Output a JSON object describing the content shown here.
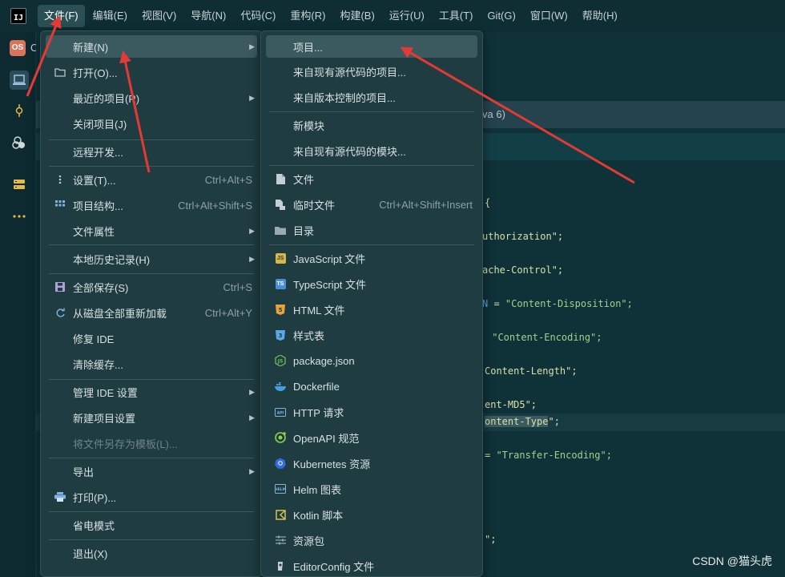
{
  "menubar": {
    "logo": "IJ",
    "items": [
      "文件(F)",
      "编辑(E)",
      "视图(V)",
      "导航(N)",
      "代码(C)",
      "重构(R)",
      "构建(B)",
      "运行(U)",
      "工具(T)",
      "Git(G)",
      "窗口(W)",
      "帮助(H)"
    ]
  },
  "sidebar": {
    "project_badge": "OS",
    "project_initial": "O"
  },
  "editor": {
    "java_hint": "va 6)",
    "lines": [
      {
        "t": "{"
      },
      {
        "t": "uthorization\";"
      },
      {
        "t": "ache-Control\";"
      },
      {
        "a": "N",
        "b": " = ",
        "c": "\"Content-Disposition\";"
      },
      {
        "b": " ",
        "c": "\"Content-Encoding\";"
      },
      {
        "t": "Content-Length\";"
      },
      {
        "t": "ent-MD5\";"
      },
      {
        "s": "ontent-Type",
        "t2": "\";"
      },
      {
        "b": "= ",
        "c": "\"Transfer-Encoding\";"
      },
      {
        "t": "\";"
      }
    ]
  },
  "file_menu": {
    "items": [
      {
        "icon": "",
        "label": "新建(N)",
        "shortcut": "",
        "arrow": true,
        "highlight": true
      },
      {
        "icon": "folder-icon",
        "label": "打开(O)...",
        "shortcut": "",
        "arrow": false
      },
      {
        "icon": "",
        "label": "最近的项目(R)",
        "shortcut": "",
        "arrow": true
      },
      {
        "icon": "",
        "label": "关闭项目(J)",
        "shortcut": "",
        "arrow": false
      },
      {
        "icon": "",
        "label": "远程开发...",
        "shortcut": "",
        "arrow": false
      },
      {
        "icon": "more-vert-icon",
        "label": "设置(T)...",
        "shortcut": "Ctrl+Alt+S",
        "arrow": false
      },
      {
        "icon": "grid-icon",
        "label": "项目结构...",
        "shortcut": "Ctrl+Alt+Shift+S",
        "arrow": false
      },
      {
        "icon": "",
        "label": "文件属性",
        "shortcut": "",
        "arrow": true
      },
      {
        "icon": "",
        "label": "本地历史记录(H)",
        "shortcut": "",
        "arrow": true
      },
      {
        "icon": "save-icon",
        "label": "全部保存(S)",
        "shortcut": "Ctrl+S",
        "arrow": false
      },
      {
        "icon": "reload-icon",
        "label": "从磁盘全部重新加载",
        "shortcut": "Ctrl+Alt+Y",
        "arrow": false
      },
      {
        "icon": "",
        "label": "修复 IDE",
        "shortcut": "",
        "arrow": false
      },
      {
        "icon": "",
        "label": "清除缓存...",
        "shortcut": "",
        "arrow": false
      },
      {
        "icon": "",
        "label": "管理 IDE 设置",
        "shortcut": "",
        "arrow": true
      },
      {
        "icon": "",
        "label": "新建项目设置",
        "shortcut": "",
        "arrow": true
      },
      {
        "icon": "",
        "label": "将文件另存为模板(L)...",
        "shortcut": "",
        "arrow": false,
        "disabled": true
      },
      {
        "icon": "",
        "label": "导出",
        "shortcut": "",
        "arrow": true
      },
      {
        "icon": "printer-icon",
        "label": "打印(P)...",
        "shortcut": "",
        "arrow": false
      },
      {
        "icon": "",
        "label": "省电模式",
        "shortcut": "",
        "arrow": false
      },
      {
        "icon": "",
        "label": "退出(X)",
        "shortcut": "",
        "arrow": false
      }
    ]
  },
  "new_menu": {
    "items": [
      {
        "icon": "",
        "label": "项目...",
        "shortcut": "",
        "highlight": true
      },
      {
        "icon": "",
        "label": "来自现有源代码的项目...",
        "shortcut": ""
      },
      {
        "icon": "",
        "label": "来自版本控制的项目...",
        "shortcut": ""
      },
      {
        "icon": "",
        "label": "新模块",
        "shortcut": ""
      },
      {
        "icon": "",
        "label": "来自现有源代码的模块...",
        "shortcut": ""
      },
      {
        "icon": "file-icon",
        "label": "文件",
        "shortcut": ""
      },
      {
        "icon": "scratch-file-icon",
        "label": "临时文件",
        "shortcut": "Ctrl+Alt+Shift+Insert"
      },
      {
        "icon": "directory-icon",
        "label": "目录",
        "shortcut": ""
      },
      {
        "icon": "javascript-icon",
        "label": "JavaScript 文件",
        "shortcut": ""
      },
      {
        "icon": "typescript-icon",
        "label": "TypeScript 文件",
        "shortcut": ""
      },
      {
        "icon": "html-icon",
        "label": "HTML 文件",
        "shortcut": ""
      },
      {
        "icon": "css-icon",
        "label": "样式表",
        "shortcut": ""
      },
      {
        "icon": "nodejs-icon",
        "label": "package.json",
        "shortcut": ""
      },
      {
        "icon": "docker-icon",
        "label": "Dockerfile",
        "shortcut": ""
      },
      {
        "icon": "http-icon",
        "label": "HTTP 请求",
        "shortcut": ""
      },
      {
        "icon": "openapi-icon",
        "label": "OpenAPI 规范",
        "shortcut": ""
      },
      {
        "icon": "kubernetes-icon",
        "label": "Kubernetes 资源",
        "shortcut": ""
      },
      {
        "icon": "helm-icon",
        "label": "Helm 图表",
        "shortcut": ""
      },
      {
        "icon": "kotlin-icon",
        "label": "Kotlin 脚本",
        "shortcut": ""
      },
      {
        "icon": "resource-bundle-icon",
        "label": "资源包",
        "shortcut": ""
      },
      {
        "icon": "editorconfig-icon",
        "label": "EditorConfig 文件",
        "shortcut": ""
      }
    ]
  },
  "colors": {
    "annotation_arrow": "#e53935",
    "menu_bg": "#1f3c41",
    "highlight": "#3b5a5f"
  },
  "watermark": "CSDN @猫头虎"
}
